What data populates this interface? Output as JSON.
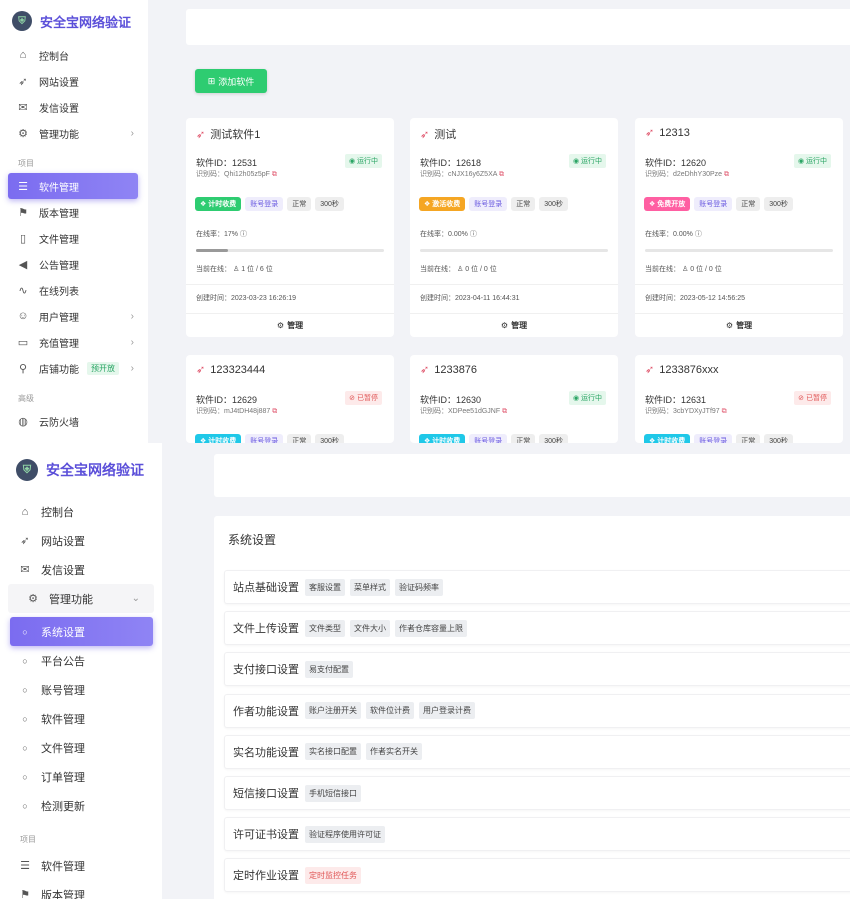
{
  "brand": {
    "name": "安全宝网络验证"
  },
  "nav_top": [
    {
      "label": "控制台",
      "icon": "home-icon"
    },
    {
      "label": "网站设置",
      "icon": "rocket-icon"
    },
    {
      "label": "发信设置",
      "icon": "mail-icon"
    },
    {
      "label": "管理功能",
      "icon": "modules-icon"
    }
  ],
  "section_project": "项目",
  "section_advanced": "高级",
  "nav_project": [
    {
      "label": "软件管理",
      "icon": "server-icon"
    },
    {
      "label": "版本管理",
      "icon": "bookmark-icon"
    },
    {
      "label": "文件管理",
      "icon": "file-icon"
    },
    {
      "label": "公告管理",
      "icon": "megaphone-icon"
    },
    {
      "label": "在线列表",
      "icon": "pulse-icon"
    },
    {
      "label": "用户管理",
      "icon": "users-icon"
    },
    {
      "label": "充值管理",
      "icon": "card-icon"
    },
    {
      "label": "店铺功能",
      "icon": "pin-icon",
      "tag": "预开放"
    }
  ],
  "nav_advanced": [
    {
      "label": "云防火墙",
      "icon": "globe-icon"
    }
  ],
  "submenu": [
    {
      "label": "系统设置"
    },
    {
      "label": "平台公告"
    },
    {
      "label": "账号管理"
    },
    {
      "label": "软件管理"
    },
    {
      "label": "文件管理"
    },
    {
      "label": "订单管理"
    },
    {
      "label": "检测更新"
    }
  ],
  "add_button": "添加软件",
  "labels": {
    "sid": "软件ID：",
    "scode": "识别码：",
    "rate": "在线率：",
    "online": "当前在线：",
    "created": "创建时间：",
    "manage": "管理",
    "acct": "账号登录",
    "normal": "正常"
  },
  "cards": [
    {
      "name": "测试软件1",
      "id": "12531",
      "code": "Qhi12h05z5pF",
      "status": "运行中",
      "mode": "计时收费",
      "mode_color": "#2ecc71",
      "interval": "300秒",
      "rate": "17%",
      "rate_value": 0.17,
      "online": "1 位 / 6 位",
      "created": "2023-03-23 16:26:19"
    },
    {
      "name": "测试",
      "id": "12618",
      "code": "cNJX16y6Z5XA",
      "status": "运行中",
      "mode": "激活收费",
      "mode_color": "#f5a623",
      "interval": "300秒",
      "rate": "0.00%",
      "rate_value": 0,
      "online": "0 位 / 0 位",
      "created": "2023-04-11 16:44:31"
    },
    {
      "name": "12313",
      "id": "12620",
      "code": "d2eDhhY30Pze",
      "status": "运行中",
      "mode": "免费开放",
      "mode_color": "#ff5fa2",
      "interval": "300秒",
      "rate": "0.00%",
      "rate_value": 0,
      "online": "0 位 / 0 位",
      "created": "2023-05-12 14:56:25"
    },
    {
      "name": "123323444",
      "id": "12629",
      "code": "mJ4tDH48j887",
      "status": "已暂停",
      "mode": "计时收费",
      "mode_color": "#1fc8e8",
      "interval": "300秒"
    },
    {
      "name": "1233876",
      "id": "12630",
      "code": "XDPee51dGJNF",
      "status": "运行中",
      "mode": "计时收费",
      "mode_color": "#1fc8e8",
      "interval": "300秒"
    },
    {
      "name": "1233876xxx",
      "id": "12631",
      "code": "3cbYDXyJTf97",
      "status": "已暂停",
      "mode": "计时收费",
      "mode_color": "#1fc8e8",
      "interval": "300秒"
    }
  ],
  "settings": {
    "title": "系统设置",
    "rows": [
      {
        "name": "站点基础设置",
        "chips": [
          "客服设置",
          "菜单样式",
          "验证码频率"
        ]
      },
      {
        "name": "文件上传设置",
        "chips": [
          "文件类型",
          "文件大小",
          "作者仓库容量上限"
        ]
      },
      {
        "name": "支付接口设置",
        "chips": [
          "易支付配置"
        ]
      },
      {
        "name": "作者功能设置",
        "chips": [
          "账户注册开关",
          "软件位计费",
          "用户登录计费"
        ]
      },
      {
        "name": "实名功能设置",
        "chips": [
          "实名接口配置",
          "作者实名开关"
        ]
      },
      {
        "name": "短信接口设置",
        "chips": [
          "手机短信接口"
        ]
      },
      {
        "name": "许可证书设置",
        "chips": [
          "验证程序使用许可证"
        ]
      },
      {
        "name": "定时作业设置",
        "chips": [
          "定时监控任务"
        ],
        "chip_red": true
      }
    ]
  },
  "colors": {
    "accent": "#7b6cf0",
    "brand": "#5b4fd9",
    "success": "#2ecc71",
    "danger": "#e05555"
  }
}
